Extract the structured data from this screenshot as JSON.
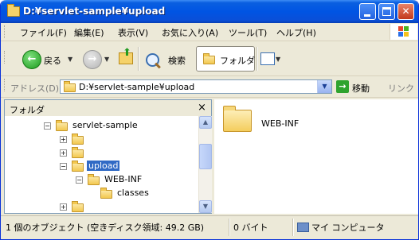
{
  "window": {
    "title": "D:¥servlet-sample¥upload"
  },
  "menu": {
    "items": [
      "ファイル(F)",
      "編集(E)",
      "表示(V)",
      "お気に入り(A)",
      "ツール(T)",
      "ヘルプ(H)"
    ]
  },
  "toolbar": {
    "back_label": "戻る",
    "search_label": "検索",
    "folders_label": "フォルダ"
  },
  "address": {
    "label": "アドレス(D)",
    "value": "D:¥servlet-sample¥upload",
    "go_label": "移動",
    "links_label": "リンク"
  },
  "folder_pane": {
    "title": "フォルダ",
    "close_glyph": "×",
    "tree": [
      {
        "label": "servlet-sample",
        "expander": "−",
        "selected": false
      },
      {
        "label": "",
        "expander": "+",
        "selected": false
      },
      {
        "label": "",
        "expander": "+",
        "selected": false
      },
      {
        "label": "upload",
        "expander": "−",
        "selected": true
      },
      {
        "label": "WEB-INF",
        "expander": "−",
        "selected": false
      },
      {
        "label": "classes",
        "expander": "",
        "selected": false
      },
      {
        "label": "",
        "expander": "+",
        "selected": false
      }
    ]
  },
  "content": {
    "items": [
      {
        "name": "WEB-INF",
        "icon": "folder-icon"
      }
    ]
  },
  "status": {
    "objects": "1 個のオブジェクト (空きディスク領域: 49.2 GB)",
    "size": "0 バイト",
    "location": "マイ コンピュータ"
  }
}
